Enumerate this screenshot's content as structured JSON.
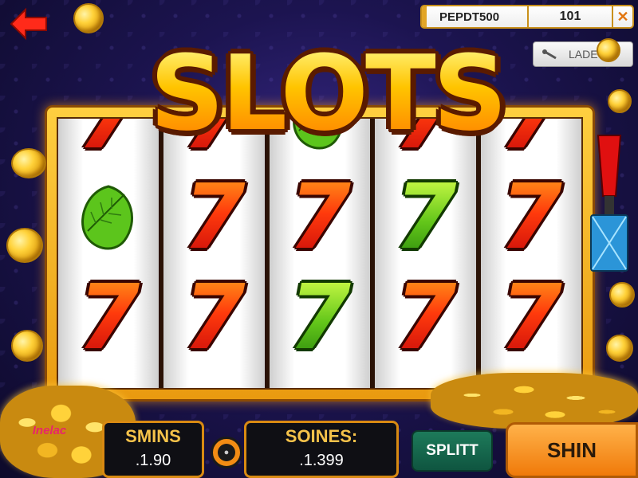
{
  "title": "SLOTS",
  "top_bar": {
    "code": "PEPDT500",
    "value": "101",
    "close_symbol": "✕"
  },
  "lade_button": {
    "label": "LADE"
  },
  "reels": [
    {
      "symbols": [
        {
          "type": "seven",
          "color": "red"
        },
        {
          "type": "lime",
          "color": "green"
        },
        {
          "type": "seven",
          "color": "red"
        }
      ]
    },
    {
      "symbols": [
        {
          "type": "seven",
          "color": "red"
        },
        {
          "type": "seven",
          "color": "red"
        },
        {
          "type": "seven",
          "color": "red"
        }
      ]
    },
    {
      "symbols": [
        {
          "type": "lime",
          "color": "green"
        },
        {
          "type": "seven",
          "color": "red"
        },
        {
          "type": "seven",
          "color": "green"
        }
      ]
    },
    {
      "symbols": [
        {
          "type": "seven",
          "color": "red"
        },
        {
          "type": "seven",
          "color": "green"
        },
        {
          "type": "seven",
          "color": "red"
        }
      ]
    },
    {
      "symbols": [
        {
          "type": "seven",
          "color": "red"
        },
        {
          "type": "seven",
          "color": "red"
        },
        {
          "type": "seven",
          "color": "red"
        }
      ]
    }
  ],
  "spins": {
    "label": "SMINS",
    "value": ".1.90"
  },
  "coins": {
    "label": "SOINES:",
    "value": ".1.399"
  },
  "split_button": {
    "label": "SPLITT"
  },
  "spin_button": {
    "label": "SHIN"
  },
  "brand_logo": "Inelac",
  "icons": {
    "back": "back-arrow-icon",
    "lever": "lever-icon",
    "circle": "circle-button-icon"
  },
  "colors": {
    "accent_orange": "#f07a0a",
    "frame_gold": "#e99a10",
    "seven_red": "#e8200c",
    "seven_green": "#63c61a",
    "background": "#1c1450"
  }
}
